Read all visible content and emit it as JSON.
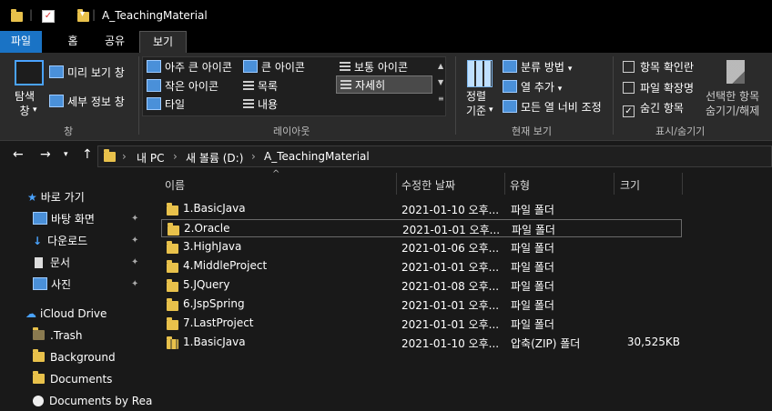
{
  "titlebar": {
    "title": "A_TeachingMaterial"
  },
  "tabs": [
    "파일",
    "홈",
    "공유",
    "보기"
  ],
  "ribbon": {
    "pane": {
      "navigation_pane": "탐색\n창",
      "preview_pane": "미리 보기 창",
      "details_pane": "세부 정보 창",
      "group": "창"
    },
    "layout": {
      "items": [
        "아주 큰 아이콘",
        "큰 아이콘",
        "보통 아이콘",
        "작은 아이콘",
        "목록",
        "자세히",
        "타일",
        "내용"
      ],
      "selected": "자세히",
      "group": "레이아웃"
    },
    "current_view": {
      "sort_by": "정렬\n기준",
      "group_by": "분류 방법",
      "add_columns": "열 추가",
      "size_all_columns": "모든 열 너비 조정",
      "group": "현재 보기"
    },
    "show_hide": {
      "item_checkboxes": "항목 확인란",
      "file_extensions": "파일 확장명",
      "hidden_items": "숨긴 항목",
      "hide_selected": "선택한 항목\n숨기기/해제",
      "group": "표시/숨기기",
      "checks": {
        "item_checkboxes": false,
        "file_extensions": false,
        "hidden_items": true
      }
    }
  },
  "address": {
    "crumbs": [
      "내 PC",
      "새 볼륨 (D:)",
      "A_TeachingMaterial"
    ]
  },
  "nav_pane": {
    "quick_access": "바로 가기",
    "quick_items": [
      "바탕 화면",
      "다운로드",
      "문서",
      "사진"
    ],
    "icloud": "iCloud Drive",
    "icloud_items": [
      ".Trash",
      "Background",
      "Documents",
      "Documents by Rea"
    ]
  },
  "columns": {
    "name": "이름",
    "modified": "수정한 날짜",
    "type": "유형",
    "size": "크기"
  },
  "files": [
    {
      "name": "1.BasicJava",
      "modified": "2021-01-10 오후...",
      "type": "파일 폴더",
      "size": ""
    },
    {
      "name": "2.Oracle",
      "modified": "2021-01-01 오후...",
      "type": "파일 폴더",
      "size": ""
    },
    {
      "name": "3.HighJava",
      "modified": "2021-01-06 오후...",
      "type": "파일 폴더",
      "size": ""
    },
    {
      "name": "4.MiddleProject",
      "modified": "2021-01-01 오후...",
      "type": "파일 폴더",
      "size": ""
    },
    {
      "name": "5.JQuery",
      "modified": "2021-01-08 오후...",
      "type": "파일 폴더",
      "size": ""
    },
    {
      "name": "6.JspSpring",
      "modified": "2021-01-01 오후...",
      "type": "파일 폴더",
      "size": ""
    },
    {
      "name": "7.LastProject",
      "modified": "2021-01-01 오후...",
      "type": "파일 폴더",
      "size": ""
    },
    {
      "name": "1.BasicJava",
      "modified": "2021-01-10 오후...",
      "type": "압축(ZIP) 폴더",
      "size": "30,525KB"
    }
  ],
  "selected_file_index": 1,
  "colors": {
    "file_tab": "#1a73c5",
    "folder": "#e8c14b",
    "background": "#191919",
    "ribbon": "#2b2b2b"
  }
}
